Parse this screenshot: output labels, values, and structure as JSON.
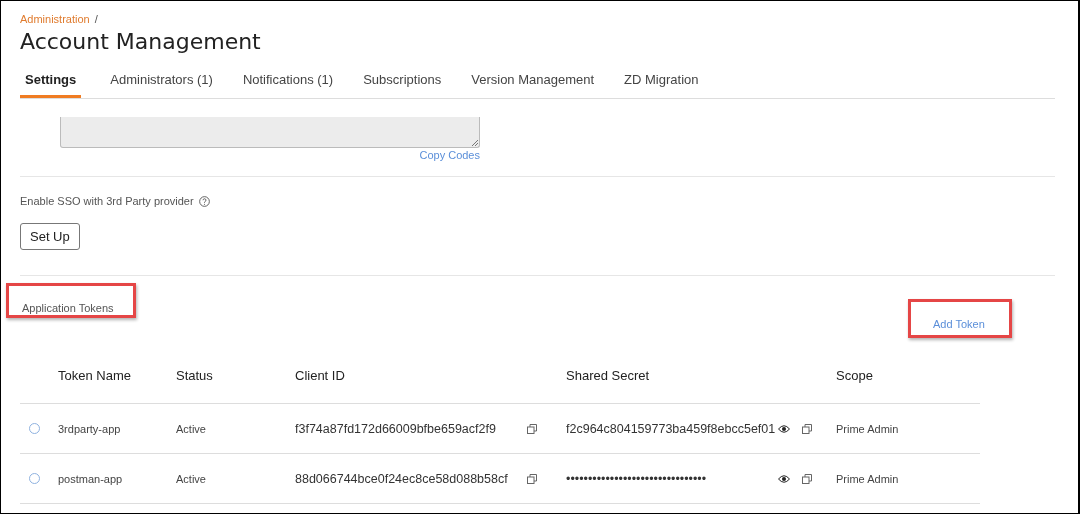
{
  "breadcrumb": {
    "link": "Administration",
    "separator": "/"
  },
  "title": "Account Management",
  "tabs": [
    {
      "label": "Settings",
      "selected": true
    },
    {
      "label": "Administrators (1)",
      "selected": false
    },
    {
      "label": "Notifications (1)",
      "selected": false
    },
    {
      "label": "Subscriptions",
      "selected": false
    },
    {
      "label": "Version Management",
      "selected": false
    },
    {
      "label": "ZD Migration",
      "selected": false
    }
  ],
  "codes": {
    "copy_link": "Copy Codes"
  },
  "sso": {
    "label": "Enable SSO with 3rd Party provider",
    "button": "Set Up"
  },
  "tokens": {
    "title": "Application Tokens",
    "title_highlighted": true,
    "add_link": "Add Token",
    "add_highlighted": true,
    "columns": [
      "Token Name",
      "Status",
      "Client ID",
      "Shared Secret",
      "Scope"
    ],
    "rows": [
      {
        "selected": false,
        "name": "3rdparty-app",
        "status": "Active",
        "client_id": "f3f74a87fd172d66009bfbe659acf2f9",
        "secret": "f2c964c804159773ba459f8ebcc5ef01",
        "scope": "Prime Admin"
      },
      {
        "selected": false,
        "name": "postman-app",
        "status": "Active",
        "client_id": "88d066744bce0f24ec8ce58d088b58cf",
        "secret": "••••••••••••••••••••••••••••••••",
        "scope": "Prime Admin"
      }
    ]
  }
}
